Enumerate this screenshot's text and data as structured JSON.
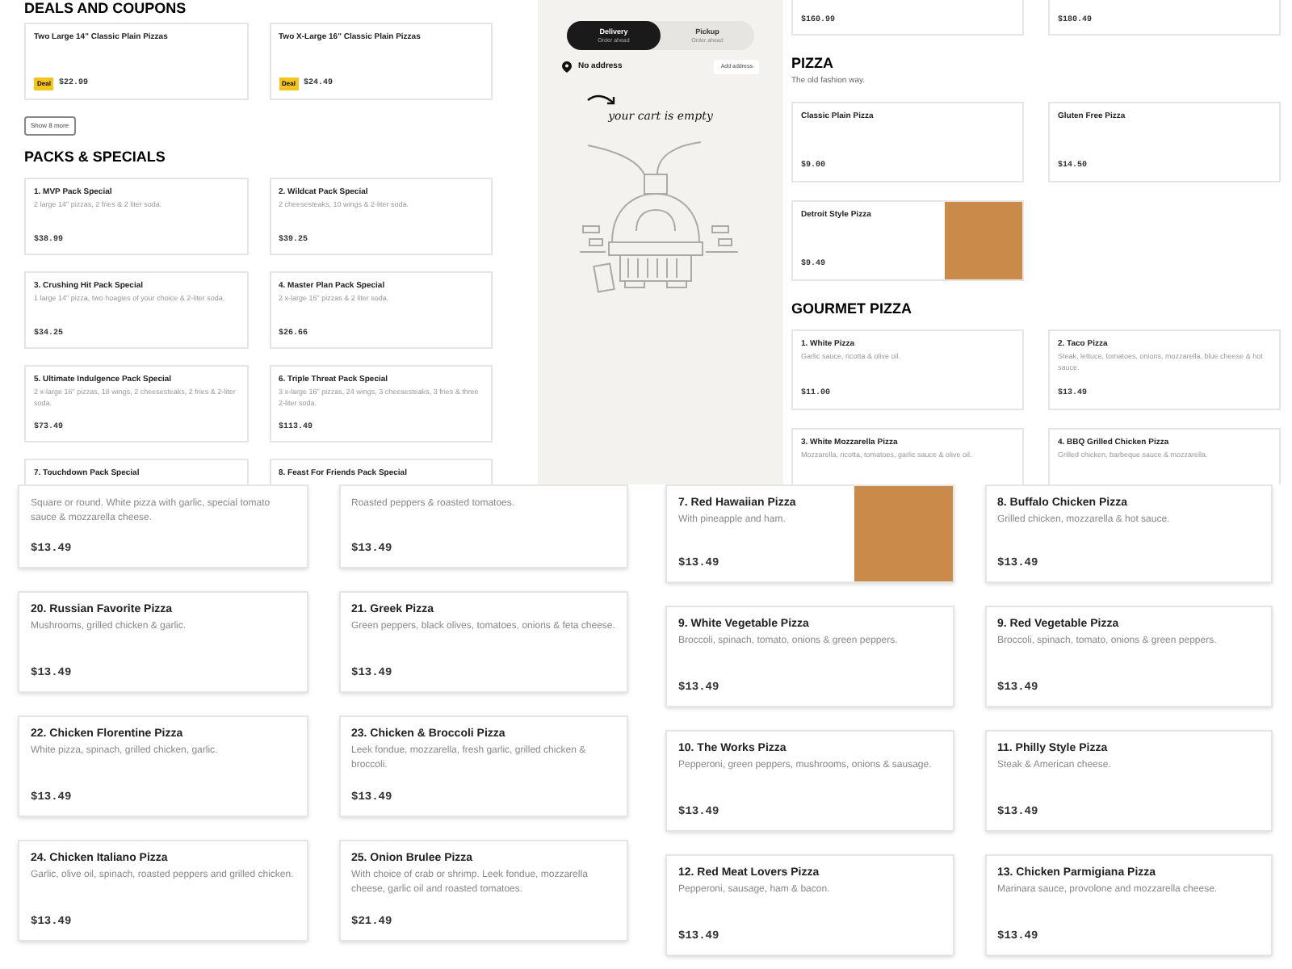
{
  "top_view": {
    "menu": {
      "sections": [
        {
          "title": "DEALS AND COUPONS",
          "show_more": "Show 8 more",
          "items": [
            {
              "name": "Two Large 14\" Classic Plain Pizzas",
              "badge": "Deal",
              "price": "$22.99"
            },
            {
              "name": "Two X-Large 16\" Classic Plain Pizzas",
              "badge": "Deal",
              "price": "$24.49"
            }
          ]
        },
        {
          "title": "PACKS & SPECIALS",
          "items": [
            {
              "name": "1. MVP Pack Special",
              "description": "2 large 14\" pizzas, 2 fries & 2 liter soda.",
              "price": "$38.99"
            },
            {
              "name": "2. Wildcat Pack Special",
              "description": "2 cheesesteaks, 10 wings & 2-liter soda.",
              "price": "$39.25"
            },
            {
              "name": "3. Crushing Hit Pack Special",
              "description": "1 large 14\" pizza, two hoagies of your choice & 2-liter soda.",
              "price": "$34.25"
            },
            {
              "name": "4. Master Plan Pack Special",
              "description": "2 x-large 16\" pizzas & 2 liter soda.",
              "price": "$26.66"
            },
            {
              "name": "5. Ultimate Indulgence Pack Special",
              "description": "2 x-large 16\" pizzas, 18 wings, 2 cheesesteaks, 2 fries & 2-liter soda.",
              "price": "$73.49"
            },
            {
              "name": "6. Triple Threat Pack Special",
              "description": "3 x-large 16\" pizzas, 24 wings, 3 cheesesteaks, 3 fries & three 2-liter soda.",
              "price": "$113.49"
            },
            {
              "name": "7. Touchdown Pack Special"
            },
            {
              "name": "8. Feast For Friends Pack Special"
            }
          ]
        }
      ]
    },
    "cart": {
      "modes": [
        {
          "label": "Delivery",
          "sublabel": "Order ahead",
          "selected": true
        },
        {
          "label": "Pickup",
          "sublabel": "Order ahead",
          "selected": false
        }
      ],
      "address": "No address",
      "add_address": "Add address",
      "empty_message": "your cart is empty"
    },
    "menu_right": {
      "sections": [
        {
          "items": [
            {
              "price": "$160.99",
              "has_photo": false
            },
            {
              "price": "$180.49",
              "has_photo": false
            }
          ]
        },
        {
          "title": "PIZZA",
          "subtitle": "The old fashion way.",
          "items": [
            {
              "name": "Classic Plain Pizza",
              "price": "$9.00",
              "has_photo": false
            },
            {
              "name": "Gluten Free Pizza",
              "price": "$14.50",
              "has_photo": false
            },
            {
              "name": "Detroit Style Pizza",
              "price": "$9.49",
              "has_photo": true
            }
          ]
        },
        {
          "title": "GOURMET PIZZA",
          "items": [
            {
              "name": "1. White Pizza",
              "description": "Garlic sauce, ricotta & olive oil.",
              "price": "$11.00",
              "has_photo": false
            },
            {
              "name": "2. Taco Pizza",
              "description": "Steak, lettuce, tomatoes, onions, mozzarella, blue cheese & hot sauce.",
              "price": "$13.49",
              "has_photo": false
            },
            {
              "name": "3. White Mozzarella Pizza",
              "description": "Mozzarella, ricotta, tomatoes, garlic sauce & olive oil.",
              "has_photo": false
            },
            {
              "name": "4. BBQ Grilled Chicken Pizza",
              "description": "Grilled chicken, barbeque sauce & mozzarella.",
              "has_photo": false
            }
          ]
        }
      ]
    }
  },
  "bottom_view": {
    "left_items": [
      {
        "description": "Square or round. White pizza with garlic, special tomato sauce & mozzarella cheese.",
        "price": "$13.49",
        "has_photo": false
      },
      {
        "description": "Roasted peppers & roasted tomatoes.",
        "price": "$13.49",
        "has_photo": false
      },
      {
        "name": "20. Russian Favorite Pizza",
        "description": "Mushrooms, grilled chicken & garlic.",
        "price": "$13.49",
        "has_photo": false
      },
      {
        "name": "21. Greek Pizza",
        "description": "Green peppers, black olives, tomatoes, onions & feta cheese.",
        "price": "$13.49",
        "has_photo": false
      },
      {
        "name": "22. Chicken Florentine Pizza",
        "description": "White pizza, spinach, grilled chicken, garlic.",
        "price": "$13.49",
        "has_photo": false
      },
      {
        "name": "23. Chicken & Broccoli Pizza",
        "description": "Leek fondue, mozzarella, fresh garlic, grilled chicken & broccoli.",
        "price": "$13.49",
        "has_photo": false
      },
      {
        "name": "24. Chicken Italiano Pizza",
        "description": "Garlic, olive oil, spinach, roasted peppers and grilled chicken.",
        "price": "$13.49",
        "has_photo": false
      },
      {
        "name": "25. Onion Brulee Pizza",
        "description": "With choice of crab or shrimp. Leek fondue, mozzarella cheese, garlic oil and roasted tomatoes.",
        "price": "$21.49",
        "has_photo": false
      }
    ],
    "right_items": [
      {
        "name": "7. Red Hawaiian Pizza",
        "description": "With pineapple and ham.",
        "price": "$13.49",
        "has_photo": true
      },
      {
        "name": "8. Buffalo Chicken Pizza",
        "description": "Grilled chicken, mozzarella & hot sauce.",
        "price": "$13.49",
        "has_photo": false
      },
      {
        "name": "9. White Vegetable Pizza",
        "description": "Broccoli, spinach, tomato, onions & green peppers.",
        "price": "$13.49",
        "has_photo": false
      },
      {
        "name": "9. Red Vegetable Pizza",
        "description": "Broccoli, spinach, tomato, onions & green peppers.",
        "price": "$13.49",
        "has_photo": false
      },
      {
        "name": "10. The Works Pizza",
        "description": "Pepperoni, green peppers, mushrooms, onions & sausage.",
        "price": "$13.49",
        "has_photo": false
      },
      {
        "name": "11. Philly Style Pizza",
        "description": "Steak & American cheese.",
        "price": "$13.49",
        "has_photo": false
      },
      {
        "name": "12. Red Meat Lovers Pizza",
        "description": "Pepperoni, sausage, ham & bacon.",
        "price": "$13.49",
        "has_photo": false
      },
      {
        "name": "13. Chicken Parmigiana Pizza",
        "description": "Marinara sauce, provolone and mozzarella cheese.",
        "price": "$13.49",
        "has_photo": false
      }
    ]
  }
}
